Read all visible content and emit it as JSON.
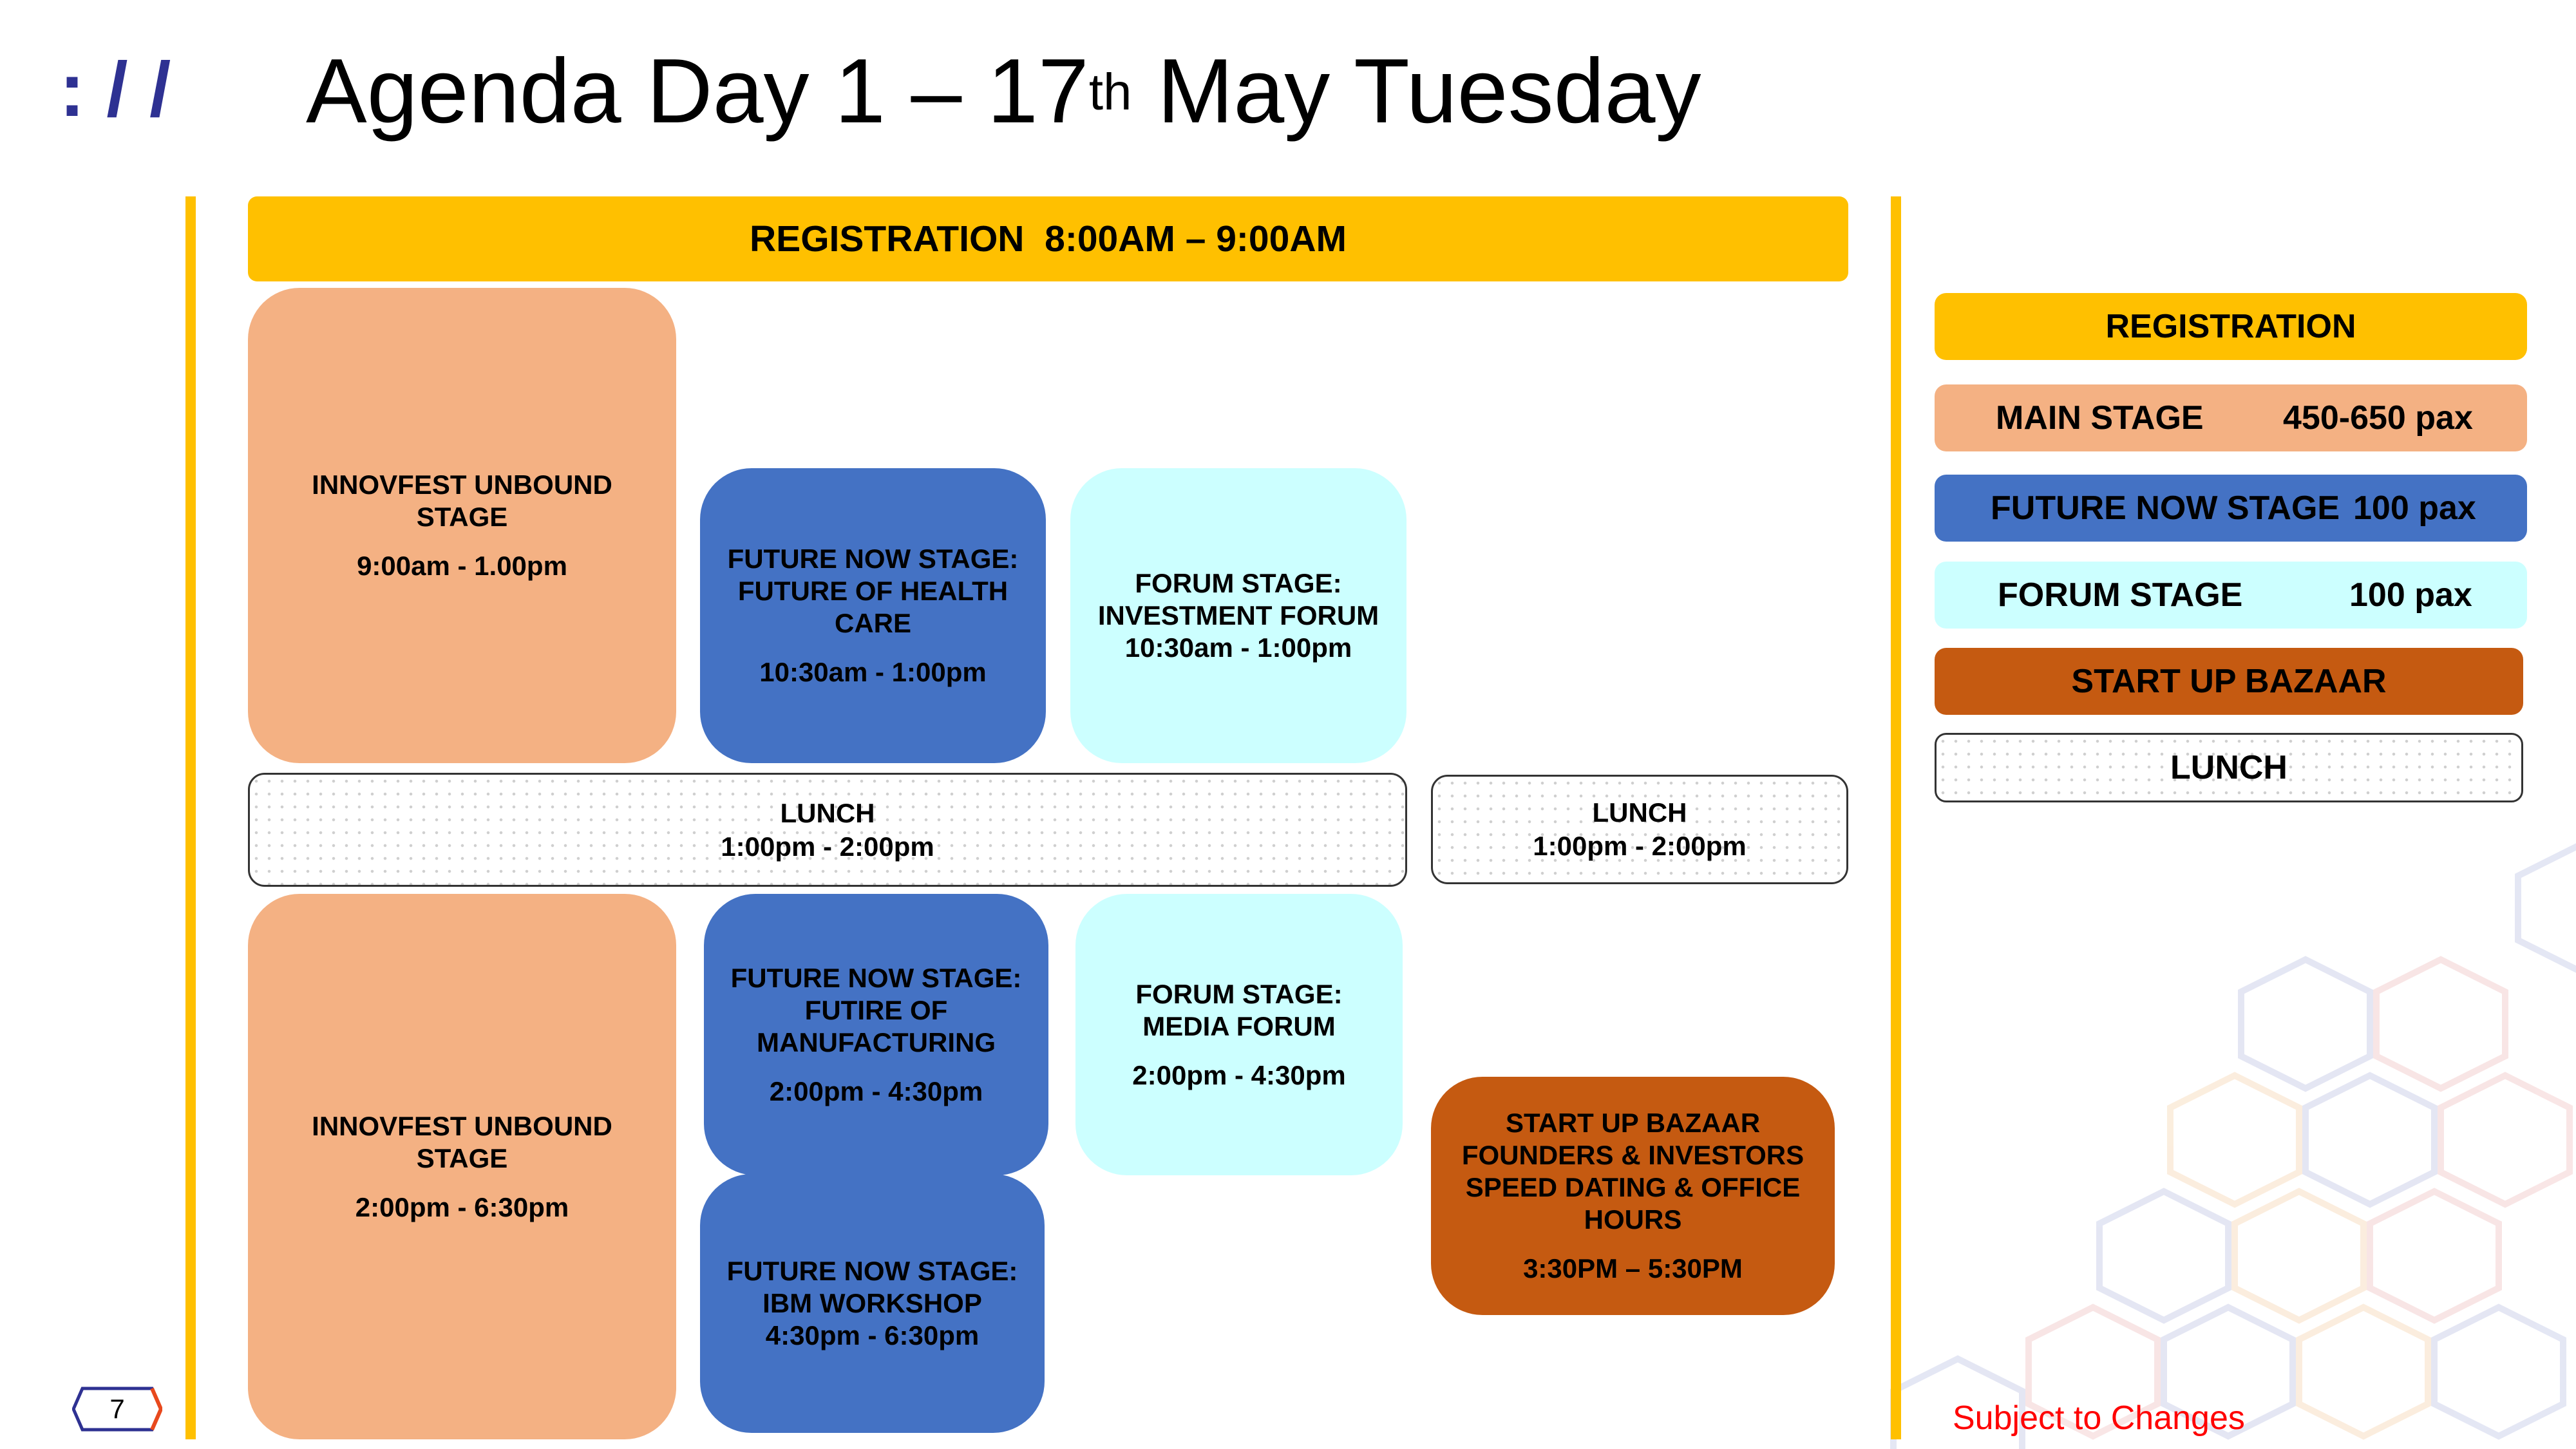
{
  "slide": {
    "logo_mark": ": / /",
    "title_main": "Agenda Day 1 – 17",
    "title_sup": "th",
    "title_rest": " May Tuesday"
  },
  "registration_banner": "REGISTRATION  8:00AM – 9:00AM",
  "sessions": {
    "main_morning": {
      "title": "INNOVFEST UNBOUND STAGE",
      "time": "9:00am - 1.00pm"
    },
    "future_morning": {
      "title": "FUTURE NOW STAGE: FUTURE OF HEALTH CARE",
      "time": "10:30am - 1:00pm"
    },
    "forum_morning": {
      "title": "FORUM STAGE: INVESTMENT FORUM 10:30am - 1:00pm"
    },
    "lunch_left": {
      "title": "LUNCH",
      "time": "1:00pm - 2:00pm"
    },
    "lunch_right": {
      "title": "LUNCH",
      "time": "1:00pm - 2:00pm"
    },
    "main_afternoon": {
      "title": "INNOVFEST UNBOUND STAGE",
      "time": "2:00pm - 6:30pm"
    },
    "future_afternoon": {
      "title": "FUTURE NOW STAGE: FUTIRE OF MANUFACTURING",
      "time": "2:00pm - 4:30pm"
    },
    "future_ibm": {
      "title": "FUTURE NOW STAGE: IBM WORKSHOP 4:30pm - 6:30pm"
    },
    "forum_afternoon": {
      "title": "FORUM STAGE: MEDIA FORUM",
      "time": "2:00pm - 4:30pm"
    },
    "bazaar": {
      "title": "START UP BAZAAR FOUNDERS & INVESTORS SPEED DATING & OFFICE HOURS",
      "time": "3:30PM – 5:30PM"
    }
  },
  "legend": {
    "registration": "REGISTRATION",
    "main_stage": "MAIN STAGE",
    "main_stage_pax": "450-650 pax",
    "future_now_stage": "FUTURE NOW STAGE",
    "future_now_pax": "100 pax",
    "forum_stage": "FORUM STAGE",
    "forum_pax": "100 pax",
    "start_up_bazaar": "START UP BAZAAR",
    "lunch": "LUNCH"
  },
  "footer": {
    "note": "Subject to Changes",
    "page_number": "7"
  },
  "colors": {
    "registration": "#FFC000",
    "main_stage": "#F4B183",
    "future_now_stage": "#4472C4",
    "forum_stage": "#CCFFFF",
    "start_up_bazaar": "#C55A11",
    "note": "#FF0000",
    "logo": "#2E3192"
  }
}
